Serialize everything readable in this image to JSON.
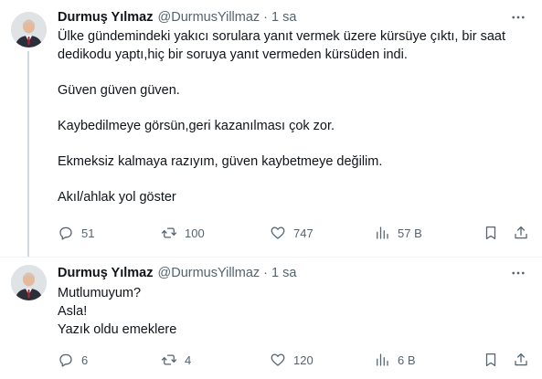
{
  "tweets": [
    {
      "author": {
        "name": "Durmuş Yılmaz",
        "handle": "@DurmusYillmaz"
      },
      "dot": "·",
      "time": "1 sa",
      "more_icon": "more-icon",
      "paragraphs": [
        "Ülke gündemindeki yakıcı sorulara yanıt vermek üzere kürsüye çıktı, bir saat dedikodu yaptı,hiç bir soruya yanıt vermeden kürsüden indi.",
        "Güven güven güven.",
        "Kaybedilmeye görsün,geri kazanılması çok zor.",
        "Ekmeksiz kalmaya razıyım, güven kaybetmeye değilim.",
        "Akıl/ahlak yol göster"
      ],
      "stats": {
        "replies": "51",
        "retweets": "100",
        "likes": "747",
        "views": "57 B"
      }
    },
    {
      "author": {
        "name": "Durmuş Yılmaz",
        "handle": "@DurmusYillmaz"
      },
      "dot": "·",
      "time": "1 sa",
      "more_icon": "more-icon",
      "lines": [
        "Mutlumuyum?",
        "Asla!",
        "Yazık oldu emeklere"
      ],
      "stats": {
        "replies": "6",
        "retweets": "4",
        "likes": "120",
        "views": "6 B"
      }
    }
  ],
  "colors": {
    "text": "#0f1419",
    "secondary": "#536471",
    "divider": "#eff3f4",
    "thread_line": "#cfd9de"
  }
}
